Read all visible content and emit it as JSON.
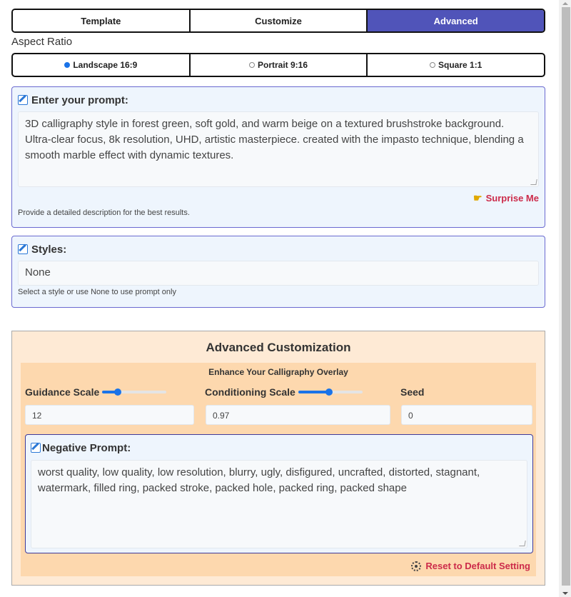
{
  "tabs": [
    {
      "label": "Template",
      "active": false
    },
    {
      "label": "Customize",
      "active": false
    },
    {
      "label": "Advanced",
      "active": true
    }
  ],
  "aspect_ratio": {
    "label": "Aspect Ratio",
    "options": [
      {
        "label": "Landscape 16:9",
        "selected": true
      },
      {
        "label": "Portrait 9:16",
        "selected": false
      },
      {
        "label": "Square 1:1",
        "selected": false
      }
    ]
  },
  "prompt": {
    "title": "Enter your prompt:",
    "value": "3D calligraphy style in forest green, soft gold, and warm beige on a textured brushstroke background. Ultra-clear focus, 8k resolution, UHD, artistic masterpiece. created with the impasto technique, blending a smooth marble effect with dynamic textures.",
    "surprise_label": "Surprise Me",
    "hint": "Provide a detailed description for the best results."
  },
  "styles": {
    "title": "Styles:",
    "value": "None",
    "hint": "Select a style or use None to use prompt only"
  },
  "advanced": {
    "title": "Advanced Customization",
    "subtitle": "Enhance Your Calligraphy Overlay",
    "guidance_scale": {
      "label": "Guidance Scale",
      "value": "12",
      "slider_fraction": 0.24
    },
    "conditioning_scale": {
      "label": "Conditioning Scale",
      "value": "0.97",
      "slider_fraction": 0.48
    },
    "seed": {
      "label": "Seed",
      "value": "0"
    },
    "negative_prompt": {
      "title": "Negative Prompt:",
      "value": "worst quality, low quality, low resolution, blurry, ugly, disfigured, uncrafted, distorted, stagnant, watermark, filled ring, packed stroke, packed hole, packed ring, packed shape"
    },
    "reset_label": "Reset to Default Setting"
  },
  "colors": {
    "active_tab": "#5054b9",
    "accent_link": "#cc2b4a",
    "slider": "#1a73e8"
  }
}
